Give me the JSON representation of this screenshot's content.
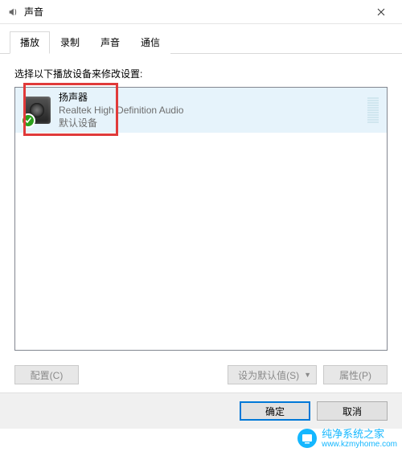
{
  "titlebar": {
    "title": "声音"
  },
  "tabs": [
    {
      "label": "播放",
      "active": true
    },
    {
      "label": "录制",
      "active": false
    },
    {
      "label": "声音",
      "active": false
    },
    {
      "label": "通信",
      "active": false
    }
  ],
  "instruction": "选择以下播放设备来修改设置:",
  "device_list": {
    "items": [
      {
        "name": "扬声器",
        "description": "Realtek High Definition Audio",
        "status": "默认设备",
        "has_check": true
      }
    ]
  },
  "buttons": {
    "configure": "配置(C)",
    "set_default": "设为默认值(S)",
    "properties": "属性(P)",
    "ok": "确定",
    "cancel": "取消"
  },
  "watermark": {
    "brand": "纯净系统之家",
    "url": "www.kzmyhome.com"
  }
}
